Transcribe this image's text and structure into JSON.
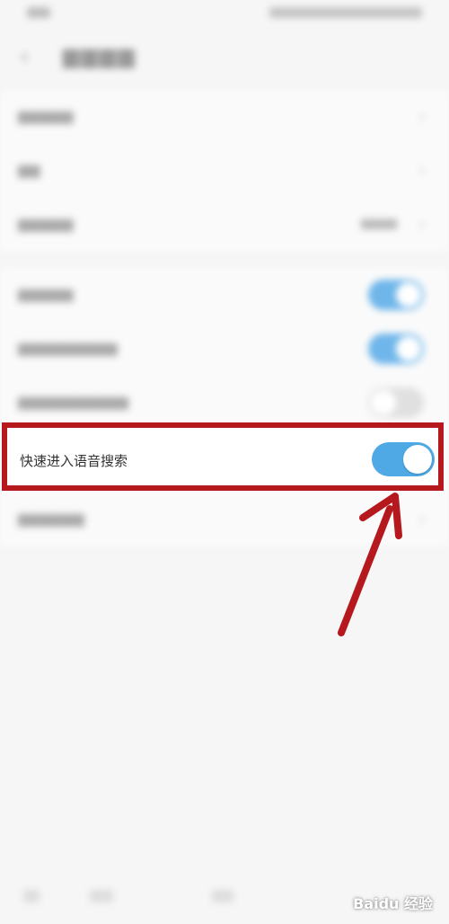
{
  "highlighted_setting": {
    "label": "快速进入语音搜索",
    "enabled": true
  },
  "colors": {
    "toggle_on": "#4ea9e5",
    "highlight_border": "#b5191d",
    "arrow": "#b5191d",
    "background": "#f6f6f6"
  },
  "icons": {
    "back": "chevron-left-icon",
    "arrow": "annotation-arrow-icon",
    "row_chevron": "chevron-right-icon"
  },
  "watermark": {
    "text": "Baidu 经验"
  }
}
